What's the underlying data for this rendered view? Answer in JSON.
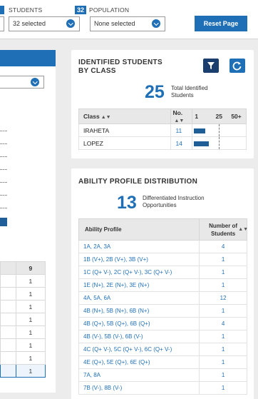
{
  "filters": {
    "students": {
      "badge": "32",
      "label": "STUDENTS",
      "value": "32 selected"
    },
    "population": {
      "badge": "32",
      "label": "POPULATION",
      "value": "None selected"
    },
    "reset_label": "Reset Page"
  },
  "left_table": {
    "header_col2": "9",
    "rows": [
      "1",
      "1",
      "1",
      "1",
      "1",
      "1",
      "1",
      "1"
    ]
  },
  "identified": {
    "title_line1": "IDENTIFIED STUDENTS",
    "title_line2": "BY CLASS",
    "total": "25",
    "caption_line1": "Total Identified",
    "caption_line2": "Students",
    "col_class": "Class",
    "col_no": "No.",
    "scale_1": "1",
    "scale_25": "25",
    "scale_50": "50+",
    "rows": [
      {
        "class": "IRAHETA",
        "no": "11",
        "value": 11
      },
      {
        "class": "LOPEZ",
        "no": "14",
        "value": 14
      }
    ]
  },
  "ability": {
    "title": "ABILITY PROFILE DISTRIBUTION",
    "total": "13",
    "caption_line1": "Differentiated Instruction",
    "caption_line2": "Opportunities",
    "col_profile": "Ability Profile",
    "col_number_line1": "Number of",
    "col_number_line2": "Students",
    "rows": [
      {
        "profile": "1A, 2A, 3A",
        "count": "4"
      },
      {
        "profile": "1B (V+), 2B (V+), 3B (V+)",
        "count": "1"
      },
      {
        "profile": "1C (Q+ V-), 2C (Q+ V-), 3C (Q+ V-)",
        "count": "1"
      },
      {
        "profile": "1E (N+), 2E (N+), 3E (N+)",
        "count": "1"
      },
      {
        "profile": "4A, 5A, 6A",
        "count": "12"
      },
      {
        "profile": "4B (N+), 5B (N+), 6B (N+)",
        "count": "1"
      },
      {
        "profile": "4B (Q+), 5B (Q+), 6B (Q+)",
        "count": "4"
      },
      {
        "profile": "4B (V-), 5B (V-), 6B (V-)",
        "count": "1"
      },
      {
        "profile": "4C (Q+ V-), 5C (Q+ V-), 6C (Q+ V-)",
        "count": "1"
      },
      {
        "profile": "4E (Q+), 5E (Q+), 6E (Q+)",
        "count": "1"
      },
      {
        "profile": "7A, 8A",
        "count": "1"
      },
      {
        "profile": "7B (V-), 8B (V-)",
        "count": "1"
      }
    ]
  },
  "colors": {
    "accent": "#1f6fb6",
    "dark": "#1a3f6e",
    "bar": "#1f5e96"
  }
}
